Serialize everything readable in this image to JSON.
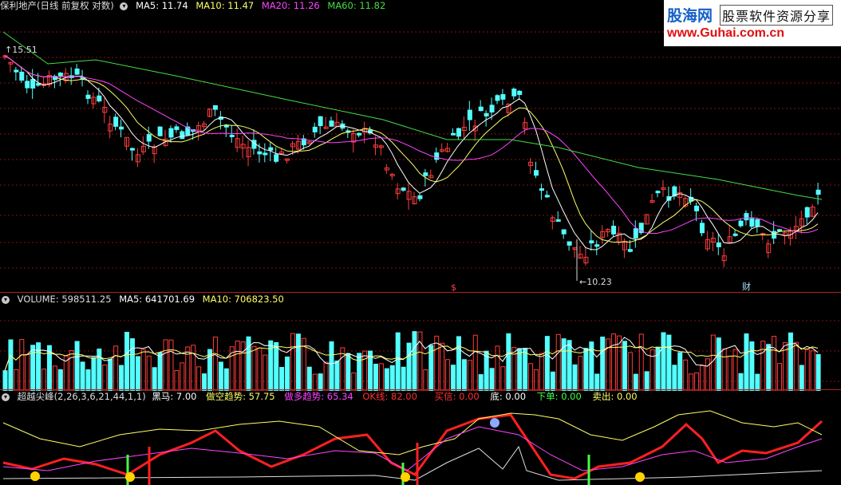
{
  "main": {
    "title": "保利地产(日线 前复权 对数)",
    "ma": [
      {
        "label": "MA5: 11.74",
        "color": "#ffffff"
      },
      {
        "label": "MA10: 11.47",
        "color": "#ffff66"
      },
      {
        "label": "MA20: 11.26",
        "color": "#ff44ff"
      },
      {
        "label": "MA60: 11.82",
        "color": "#44dd44"
      }
    ],
    "high_label": "15.51",
    "low_label": "10.23",
    "marker_s": "$",
    "marker_cai": "财"
  },
  "volume": {
    "label": "VOLUME: 598511.25",
    "ma5": "MA5: 641701.69",
    "ma10": "MA10: 706823.50"
  },
  "indicator": {
    "name": "超越尖峰(2,26,3,6,21,44,1,1)",
    "items": [
      {
        "label": "黑马: 7.00",
        "color": "#ffffff"
      },
      {
        "label": "做空趋势: 57.75",
        "color": "#ffff66"
      },
      {
        "label": "做多趋势: 65.34",
        "color": "#ff44ff"
      },
      {
        "label": "OK线: 82.00",
        "color": "#ff3030"
      },
      {
        "label": "买信: 0.00",
        "color": "#ff3030"
      },
      {
        "label": "底: 0.00",
        "color": "#ffffff"
      },
      {
        "label": "下单: 0.00",
        "color": "#44ff44"
      },
      {
        "label": "卖出: 0.00",
        "color": "#ffff66"
      }
    ]
  },
  "logo": {
    "site_cn": "股海网",
    "tag": "股票软件资源分享",
    "url": "www.Guhai.com.cn"
  },
  "colors": {
    "up": "#ff3c3c",
    "down": "#54ffff",
    "grid": "#8a1010"
  }
}
